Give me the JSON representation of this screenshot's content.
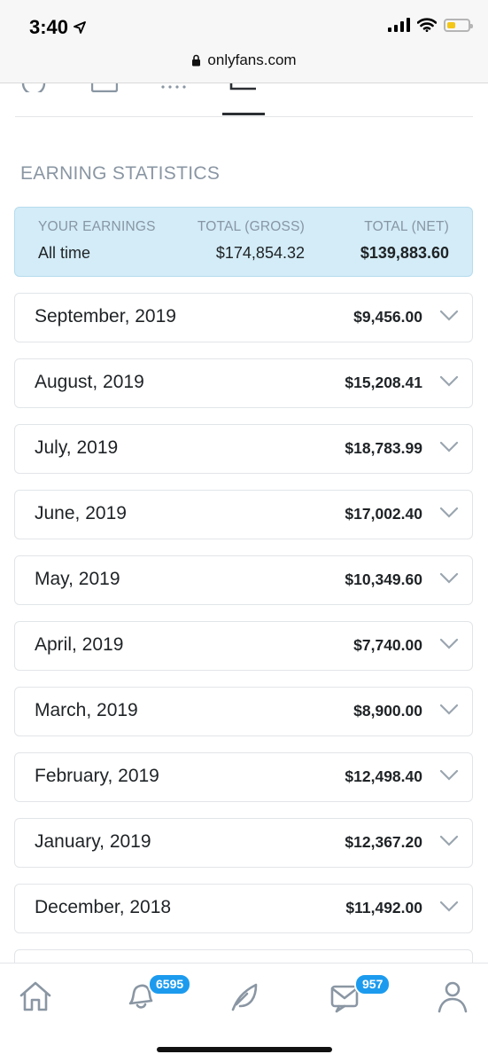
{
  "status_bar": {
    "time": "3:40",
    "location_icon": "location-arrow-icon",
    "battery_color": "#f4c618"
  },
  "browser": {
    "url": "onlyfans.com",
    "lock_icon": "lock-icon"
  },
  "tabs": {
    "icons": [
      "info-icon",
      "card-icon",
      "list-icon",
      "chart-icon"
    ],
    "active_index": 3
  },
  "earning_statistics": {
    "title": "EARNING STATISTICS",
    "headers": {
      "earnings": "YOUR EARNINGS",
      "gross": "TOTAL (GROSS)",
      "net": "TOTAL (NET)"
    },
    "period": "All time",
    "total_gross": "$174,854.32",
    "total_net": "$139,883.60",
    "summary_bg": "#d3ecf7"
  },
  "months": [
    {
      "label": "September, 2019",
      "amount": "$9,456.00"
    },
    {
      "label": "August, 2019",
      "amount": "$15,208.41"
    },
    {
      "label": "July, 2019",
      "amount": "$18,783.99"
    },
    {
      "label": "June, 2019",
      "amount": "$17,002.40"
    },
    {
      "label": "May, 2019",
      "amount": "$10,349.60"
    },
    {
      "label": "April, 2019",
      "amount": "$7,740.00"
    },
    {
      "label": "March, 2019",
      "amount": "$8,900.00"
    },
    {
      "label": "February, 2019",
      "amount": "$12,498.40"
    },
    {
      "label": "January, 2019",
      "amount": "$12,367.20"
    },
    {
      "label": "December, 2018",
      "amount": "$11,492.00"
    }
  ],
  "bottom_nav": {
    "items": [
      "home-icon",
      "notifications-icon",
      "feather-icon",
      "messages-icon",
      "profile-icon"
    ],
    "notifications_badge": "6595",
    "messages_badge": "957",
    "accent": "#1c9bee"
  }
}
